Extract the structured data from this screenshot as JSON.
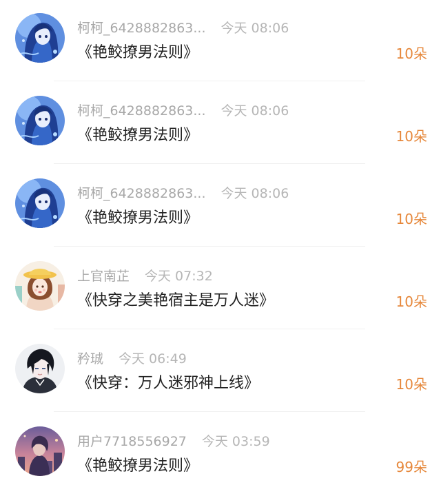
{
  "gift_list": [
    {
      "name": "柯柯_6428882863...",
      "time": "今天 08:06",
      "book": "《艳鲛撩男法则》",
      "amount": "10朵",
      "avatar": "blue-anime-girl-avatar"
    },
    {
      "name": "柯柯_6428882863...",
      "time": "今天 08:06",
      "book": "《艳鲛撩男法则》",
      "amount": "10朵",
      "avatar": "blue-anime-girl-avatar"
    },
    {
      "name": "柯柯_6428882863...",
      "time": "今天 08:06",
      "book": "《艳鲛撩男法则》",
      "amount": "10朵",
      "avatar": "blue-anime-girl-avatar"
    },
    {
      "name": "上官南芷",
      "time": "今天 07:32",
      "book": "《快穿之美艳宿主是万人迷》",
      "amount": "10朵",
      "avatar": "girl-yellow-hat-avatar"
    },
    {
      "name": "矜珹",
      "time": "今天 06:49",
      "book": "《快穿：万人迷邪神上线》",
      "amount": "10朵",
      "avatar": "dark-hair-boy-avatar"
    },
    {
      "name": "用户7718556927",
      "time": "今天 03:59",
      "book": "《艳鲛撩男法则》",
      "amount": "99朵",
      "avatar": "sunset-figure-avatar"
    }
  ],
  "colors": {
    "amount": "#e6873a",
    "name": "#a8a8a8",
    "time": "#b6b6b6",
    "book": "#222222"
  }
}
